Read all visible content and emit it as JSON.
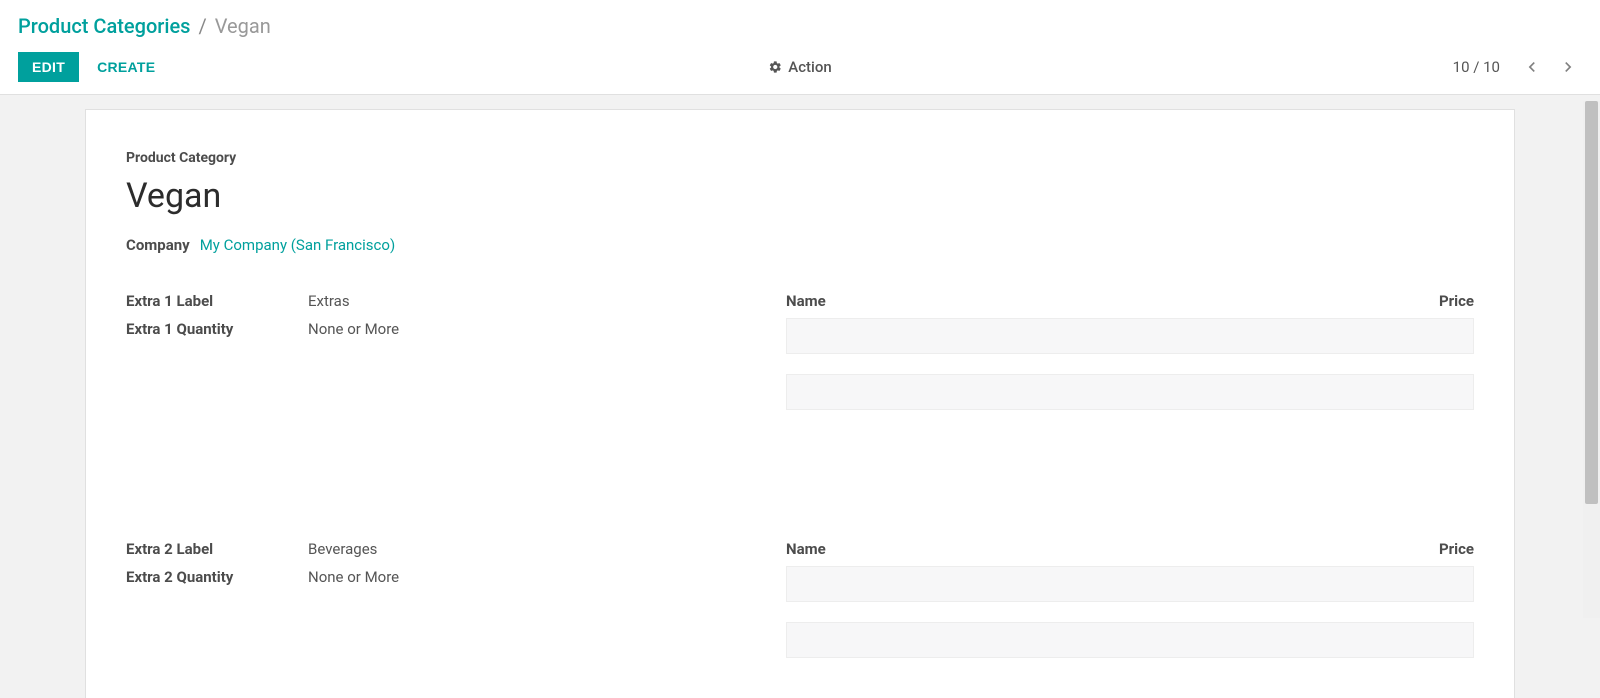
{
  "breadcrumb": {
    "parent": "Product Categories",
    "separator": "/",
    "current": "Vegan"
  },
  "toolbar": {
    "edit_label": "EDIT",
    "create_label": "CREATE",
    "action_label": "Action",
    "pager": "10 / 10"
  },
  "form": {
    "category_section_label": "Product Category",
    "category_name": "Vegan",
    "company_label": "Company",
    "company_value": "My Company (San Francisco)",
    "sections": [
      {
        "label_field": {
          "label": "Extra 1 Label",
          "value": "Extras"
        },
        "quantity_field": {
          "label": "Extra 1 Quantity",
          "value": "None or More"
        },
        "table_headers": {
          "name": "Name",
          "price": "Price"
        }
      },
      {
        "label_field": {
          "label": "Extra 2 Label",
          "value": "Beverages"
        },
        "quantity_field": {
          "label": "Extra 2 Quantity",
          "value": "None or More"
        },
        "table_headers": {
          "name": "Name",
          "price": "Price"
        }
      }
    ]
  }
}
